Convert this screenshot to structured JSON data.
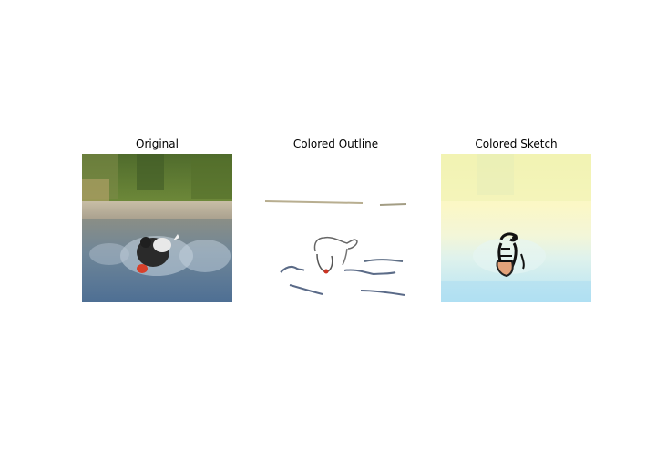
{
  "panels": [
    {
      "title": "Original"
    },
    {
      "title": "Colored Outline"
    },
    {
      "title": "Colored Sketch"
    }
  ]
}
